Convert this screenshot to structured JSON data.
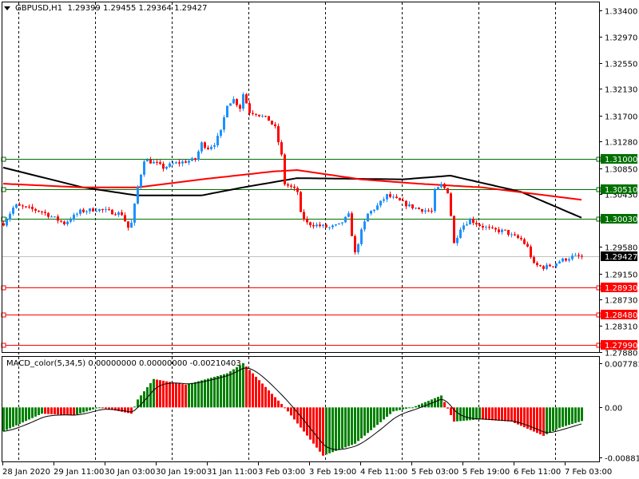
{
  "header": {
    "symbol": "GBPUSD,H1",
    "open": "1.29399",
    "high": "1.29455",
    "low": "1.29364",
    "close": "1.29427"
  },
  "macd_header": {
    "name": "MACD_color(5,34,5)",
    "v1": "0.00000000",
    "v2": "0.00000000",
    "v3": "-0.00210403"
  },
  "colors": {
    "bull": "#1e90ff",
    "bear": "#ff0000",
    "ma_fast": "#000000",
    "ma_slow": "#ff0000",
    "level_green": "#007000",
    "level_red": "#ff0000",
    "hist_up": "#008000",
    "hist_down": "#ff0000"
  },
  "chart_data": {
    "type": "candlestick",
    "bars": 182,
    "ylim": [
      1.2788,
      1.334
    ],
    "price_ticks": [
      "1.33400",
      "1.32970",
      "1.32550",
      "1.32130",
      "1.31700",
      "1.31280",
      "1.30850",
      "1.30430",
      "1.29580",
      "1.29150",
      "1.28730",
      "1.28310",
      "1.27880"
    ],
    "levels": [
      {
        "label": "1.31000",
        "value": 1.31,
        "kind": "green"
      },
      {
        "label": "1.30510",
        "value": 1.3051,
        "kind": "green"
      },
      {
        "label": "1.30030",
        "value": 1.3003,
        "kind": "green"
      },
      {
        "label": "1.28930",
        "value": 1.2893,
        "kind": "red"
      },
      {
        "label": "1.28480",
        "value": 1.2848,
        "kind": "red"
      },
      {
        "label": "1.27990",
        "value": 1.2799,
        "kind": "red"
      }
    ],
    "bid": {
      "label": "1.29427",
      "value": 1.29427
    },
    "close_anchors": [
      [
        0,
        1.2996
      ],
      [
        3.5,
        1.3025
      ],
      [
        12,
        1.3015
      ],
      [
        19,
        1.2996
      ],
      [
        24,
        1.3015
      ],
      [
        29,
        1.3019
      ],
      [
        37,
        1.3011
      ],
      [
        39,
        1.2989
      ],
      [
        40,
        1.2996
      ],
      [
        42,
        1.3054
      ],
      [
        44,
        1.3099
      ],
      [
        48,
        1.3092
      ],
      [
        50,
        1.3086
      ],
      [
        53,
        1.3092
      ],
      [
        57,
        1.3096
      ],
      [
        60,
        1.3099
      ],
      [
        62,
        1.3125
      ],
      [
        64,
        1.3118
      ],
      [
        66,
        1.3125
      ],
      [
        68,
        1.3144
      ],
      [
        70,
        1.3189
      ],
      [
        72,
        1.3196
      ],
      [
        74,
        1.3183
      ],
      [
        75,
        1.3205
      ],
      [
        77,
        1.3176
      ],
      [
        79,
        1.3174
      ],
      [
        83,
        1.3163
      ],
      [
        85,
        1.315
      ],
      [
        87,
        1.3105
      ],
      [
        88,
        1.306
      ],
      [
        90,
        1.3054
      ],
      [
        92,
        1.3047
      ],
      [
        93,
        1.3011
      ],
      [
        95,
        1.2996
      ],
      [
        98,
        1.2993
      ],
      [
        102,
        1.2989
      ],
      [
        105,
        1.2993
      ],
      [
        108,
        1.3009
      ],
      [
        110,
        1.2947
      ],
      [
        112,
        1.2983
      ],
      [
        114,
        1.3011
      ],
      [
        117,
        1.3024
      ],
      [
        120,
        1.3041
      ],
      [
        123,
        1.3034
      ],
      [
        127,
        1.3024
      ],
      [
        130,
        1.3019
      ],
      [
        134,
        1.3015
      ],
      [
        135,
        1.3047
      ],
      [
        137,
        1.3058
      ],
      [
        139,
        1.3047
      ],
      [
        140,
        1.3009
      ],
      [
        141,
        1.2963
      ],
      [
        143,
        1.2989
      ],
      [
        146,
        1.3002
      ],
      [
        149,
        1.2993
      ],
      [
        153,
        1.2985
      ],
      [
        157,
        1.2983
      ],
      [
        159,
        1.2976
      ],
      [
        162,
        1.297
      ],
      [
        164,
        1.2957
      ],
      [
        166,
        1.2929
      ],
      [
        169,
        1.2925
      ],
      [
        172,
        1.2929
      ],
      [
        174,
        1.2935
      ],
      [
        178,
        1.2942
      ],
      [
        181,
        1.29427
      ]
    ],
    "ma_fast_anchors": [
      [
        0,
        1.3086
      ],
      [
        25,
        1.3054
      ],
      [
        42,
        1.3041
      ],
      [
        62,
        1.3041
      ],
      [
        75,
        1.3054
      ],
      [
        92,
        1.3069
      ],
      [
        125,
        1.3067
      ],
      [
        140,
        1.3073
      ],
      [
        162,
        1.3047
      ],
      [
        181,
        1.3005
      ]
    ],
    "ma_slow_anchors": [
      [
        0,
        1.306
      ],
      [
        25,
        1.3054
      ],
      [
        42,
        1.3054
      ],
      [
        62,
        1.3067
      ],
      [
        85,
        1.308
      ],
      [
        92,
        1.3082
      ],
      [
        112,
        1.3067
      ],
      [
        130,
        1.306
      ],
      [
        150,
        1.3054
      ],
      [
        170,
        1.3041
      ],
      [
        181,
        1.3034
      ]
    ],
    "time_labels": [
      "28 Jan 2020",
      "29 Jan 11:00",
      "30 Jan 03:00",
      "30 Jan 19:00",
      "31 Jan 11:00",
      "3 Feb 03:00",
      "3 Feb 19:00",
      "4 Feb 11:00",
      "5 Feb 03:00",
      "5 Feb 19:00",
      "6 Feb 11:00",
      "7 Feb 03:00"
    ],
    "macd": {
      "ylim": [
        -0.008814,
        0.0077812
      ],
      "ticks": [
        "0.0077812",
        "0.00",
        "-0.008814"
      ],
      "hist_anchors": [
        [
          0,
          -0.0042
        ],
        [
          12,
          -0.0011
        ],
        [
          22,
          -0.0014
        ],
        [
          30,
          0.0
        ],
        [
          40,
          -0.0011
        ],
        [
          42,
          0.0014
        ],
        [
          47,
          0.005
        ],
        [
          57,
          0.004
        ],
        [
          70,
          0.006
        ],
        [
          75,
          0.0078
        ],
        [
          88,
          0.0
        ],
        [
          100,
          -0.0085
        ],
        [
          110,
          -0.0064
        ],
        [
          122,
          -0.0007
        ],
        [
          128,
          0.0
        ],
        [
          137,
          0.0021
        ],
        [
          141,
          -0.0025
        ],
        [
          149,
          -0.0021
        ],
        [
          159,
          -0.0025
        ],
        [
          169,
          -0.005
        ],
        [
          174,
          -0.0036
        ],
        [
          181,
          -0.0024
        ]
      ]
    }
  }
}
